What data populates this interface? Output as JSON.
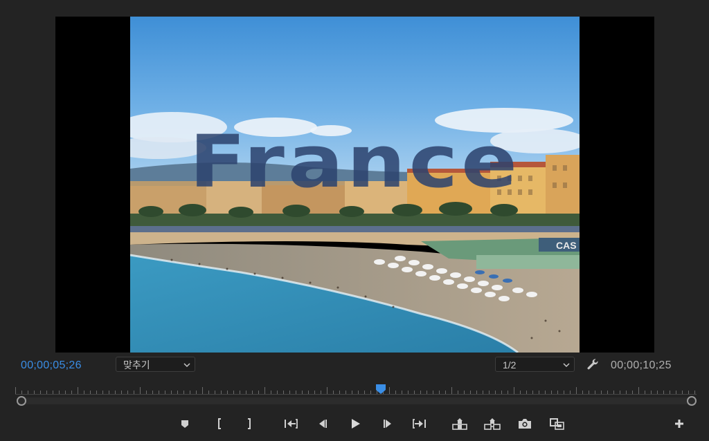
{
  "viewer": {
    "overlay_title": "France",
    "frame_sign_text": "CAS"
  },
  "controls": {
    "current_timecode": "00;00;05;26",
    "fit_dropdown": {
      "value": "맞추기",
      "icon": "chevron-down-icon"
    },
    "resolution_dropdown": {
      "value": "1/2",
      "icon": "chevron-down-icon"
    },
    "settings_icon": "wrench-icon",
    "duration_timecode": "00;00;10;25"
  },
  "timeline": {
    "playhead_position_fraction": 0.55
  },
  "transport": {
    "buttons": [
      {
        "name": "add-marker-button",
        "icon": "marker-icon"
      },
      {
        "name": "mark-in-button",
        "icon": "mark-in-icon"
      },
      {
        "name": "mark-out-button",
        "icon": "mark-out-icon"
      },
      {
        "name": "go-to-in-button",
        "icon": "go-to-in-icon"
      },
      {
        "name": "step-back-button",
        "icon": "step-back-icon"
      },
      {
        "name": "play-button",
        "icon": "play-icon"
      },
      {
        "name": "step-forward-button",
        "icon": "step-forward-icon"
      },
      {
        "name": "go-to-out-button",
        "icon": "go-to-out-icon"
      },
      {
        "name": "lift-button",
        "icon": "lift-icon"
      },
      {
        "name": "extract-button",
        "icon": "extract-icon"
      },
      {
        "name": "export-frame-button",
        "icon": "camera-icon"
      },
      {
        "name": "comparison-view-button",
        "icon": "comparison-view-icon"
      },
      {
        "name": "button-editor-button",
        "icon": "plus-icon"
      }
    ]
  },
  "colors": {
    "panel_bg": "#232323",
    "timecode_current": "#3a8ee6",
    "timecode_duration": "#b0b0b0",
    "playhead": "#3a8ee6"
  }
}
